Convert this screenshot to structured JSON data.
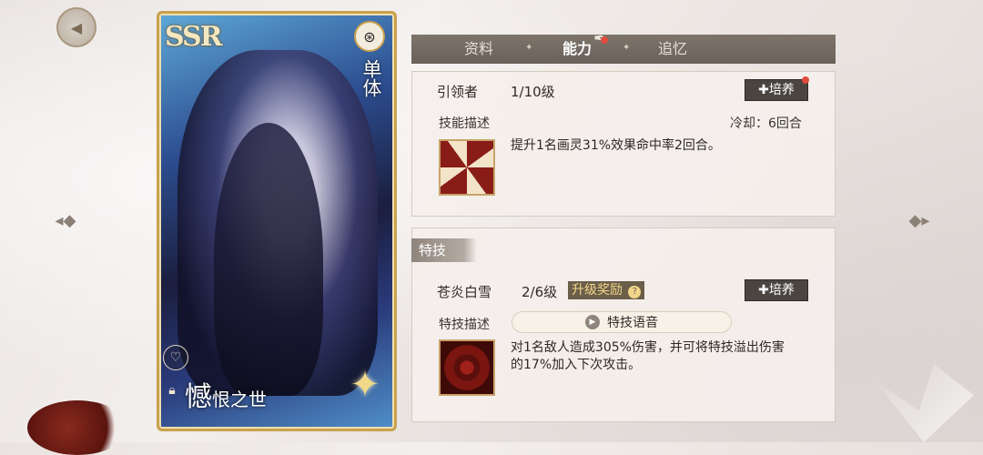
{
  "card": {
    "rarity": "SSR",
    "type_label": "单体",
    "name_main": "憾",
    "name_sub": "恨之世"
  },
  "tabs": [
    {
      "label": "资料",
      "active": false
    },
    {
      "label": "能力",
      "active": true
    },
    {
      "label": "追忆",
      "active": false
    }
  ],
  "skill": {
    "name": "引领者",
    "level": "1/10级",
    "train_label": "✚培养",
    "desc_label": "技能描述",
    "cooldown": "冷却：6回合",
    "description": "提升1名画灵31%效果命中率2回合。"
  },
  "special": {
    "section_label": "特技",
    "name": "苍炎白雪",
    "level": "2/6级",
    "upgrade_reward": "升级奖励",
    "upgrade_help": "?",
    "train_label": "✚培养",
    "desc_label": "特技描述",
    "voice_label": "特技语音",
    "description_line1": "对1名敌人造成305%伤害，并可将特技溢出伤害",
    "description_line2": "的17%加入下次攻击。"
  },
  "icons": {
    "back": "back-icon",
    "nav_left": "arrow-left-icon",
    "nav_right": "arrow-right-icon",
    "heart": "heart-icon",
    "lock": "lock-icon",
    "quill": "quill-icon",
    "play": "play-icon"
  },
  "colors": {
    "tabbar": "#6f665f",
    "accent_gold": "#c9a24f",
    "notification": "#e04b3b"
  }
}
